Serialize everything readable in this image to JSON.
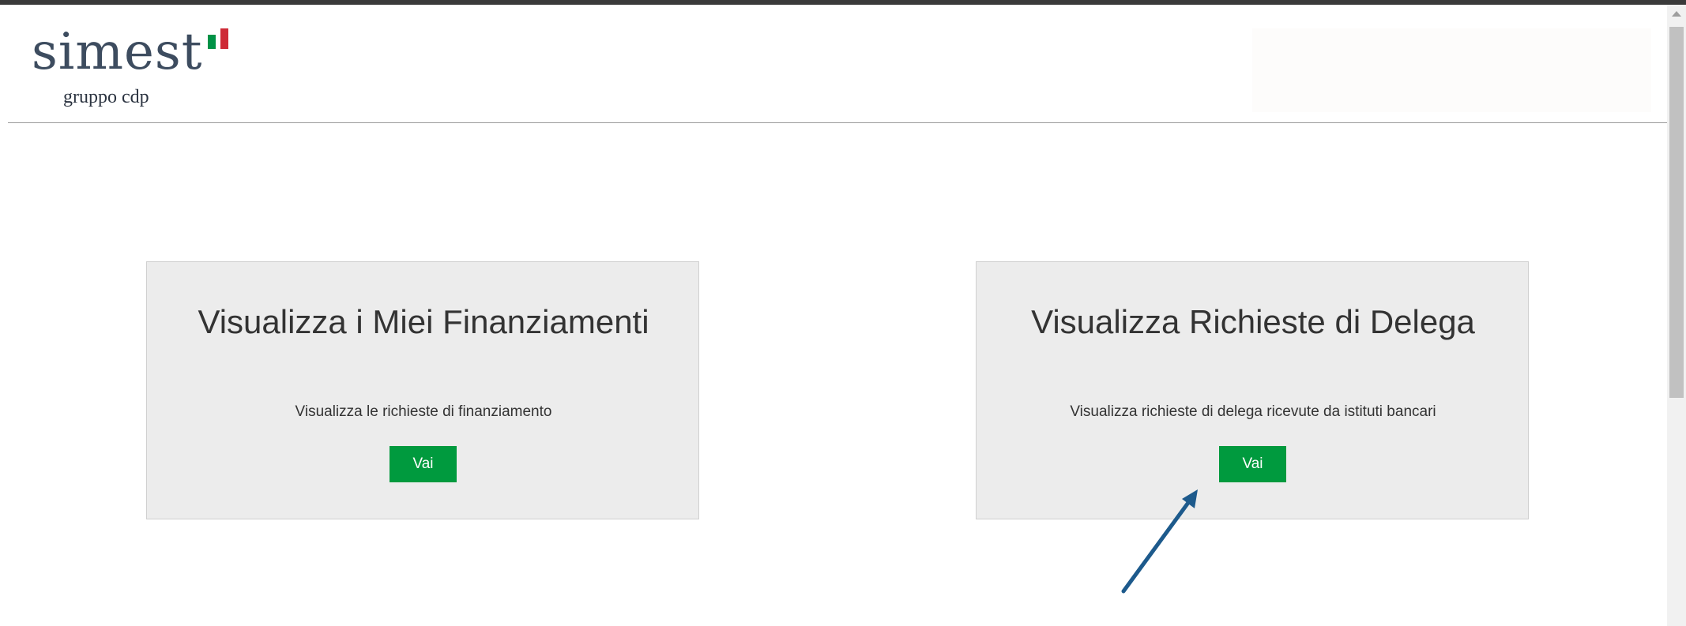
{
  "logo": {
    "word": "simest",
    "subtitle": "gruppo cdp"
  },
  "cards": [
    {
      "title": "Visualizza i Miei Finanziamenti",
      "description": "Visualizza le richieste di finanziamento",
      "button_label": "Vai"
    },
    {
      "title": "Visualizza Richieste di Delega",
      "description": "Visualizza richieste di delega ricevute da istituti bancari",
      "button_label": "Vai"
    }
  ],
  "colors": {
    "button": "#009a3e",
    "card_background": "#ececec",
    "logo_text": "#3d4c5f",
    "flag_green": "#009246",
    "flag_red": "#ce2b37",
    "annotation_arrow": "#1d5a8c"
  }
}
